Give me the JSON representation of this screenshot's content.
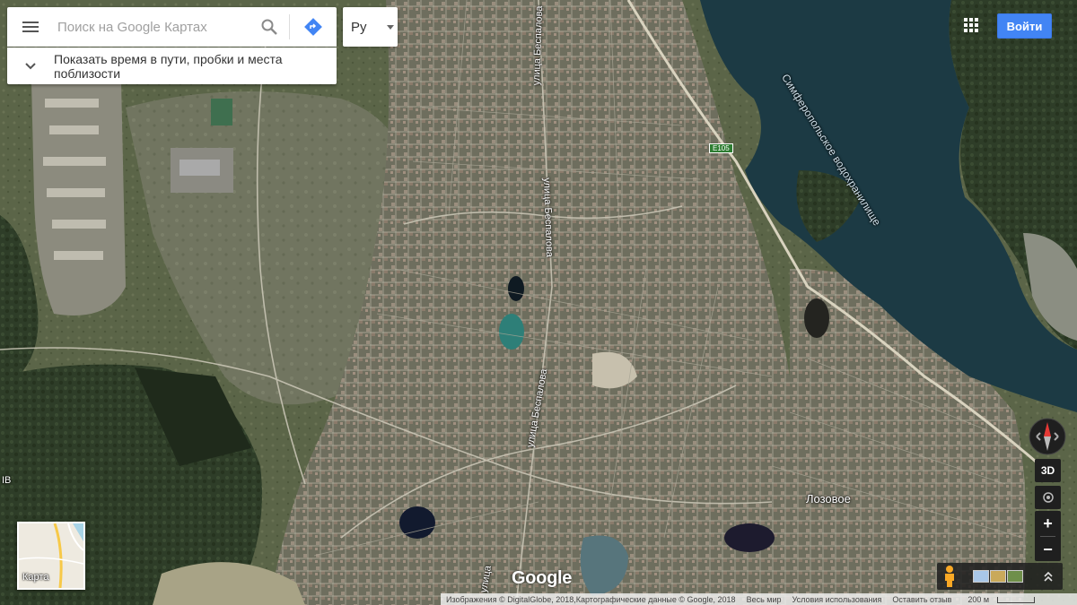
{
  "search": {
    "placeholder": "Поиск на Google Картах",
    "traffic_text": "Показать время в пути, пробки и места поблизости"
  },
  "language": {
    "label": "Ру"
  },
  "header": {
    "signin_label": "Войти"
  },
  "controls": {
    "three_d_label": "3D",
    "zoom_in_label": "+",
    "zoom_out_label": "−"
  },
  "minimap": {
    "label": "Карта"
  },
  "logo": {
    "text": "Google"
  },
  "map_labels": {
    "reservoir": "Симферопольское водохранилище",
    "street_1": "улица Беспалова",
    "street_2": "улица Беспалова",
    "street_3": "улица Беспалова",
    "highway": "E105",
    "village": "Лозовое",
    "left_edge": "IB",
    "bottom_street": "улица"
  },
  "footer": {
    "attribution": "Изображения © DigitalGlobe, 2018,Картографические данные © Google, 2018",
    "world_link": "Весь мир",
    "terms_link": "Условия использования",
    "feedback_link": "Оставить отзыв",
    "scale_label": "200 м"
  },
  "colors": {
    "accent": "#4285f4",
    "water": "#1c3a44",
    "terrain": "#4a5a3c"
  }
}
